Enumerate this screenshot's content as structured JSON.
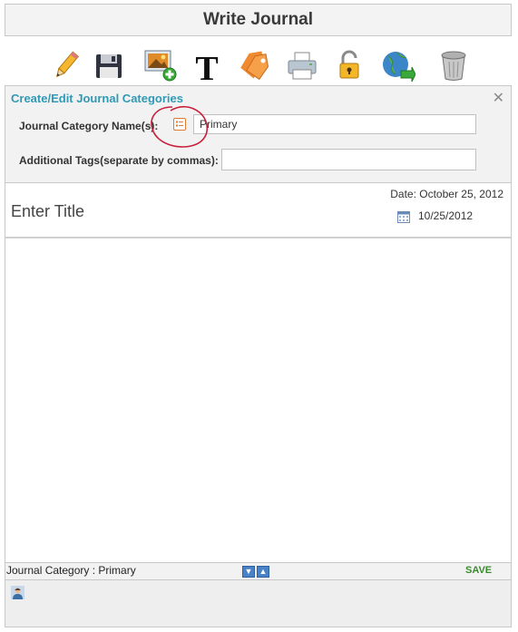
{
  "header": {
    "title": "Write Journal"
  },
  "toolbar": {
    "buttons": [
      {
        "icon": "pencil-icon"
      },
      {
        "icon": "save-icon"
      },
      {
        "icon": "add-image-icon"
      },
      {
        "icon": "text-format-icon"
      },
      {
        "icon": "tag-icon"
      },
      {
        "icon": "print-icon"
      },
      {
        "icon": "lock-icon"
      },
      {
        "icon": "globe-icon"
      },
      {
        "icon": "trash-icon"
      }
    ]
  },
  "category_panel": {
    "title": "Create/Edit Journal Categories",
    "close_label": "✕",
    "category_label": "Journal Category Name(s):",
    "category_value": "Primary",
    "tags_label": "Additional Tags(separate by commas):",
    "tags_value": ""
  },
  "entry": {
    "date_label": "Date: October 25, 2012",
    "title_placeholder": "Enter Title",
    "date_value": "10/25/2012"
  },
  "status_bar": {
    "category_text": "Journal Category : Primary",
    "down_arrow": "▼",
    "up_arrow": "▲",
    "save_label": "SAVE"
  },
  "colors": {
    "accent": "#3099b5",
    "save": "#3a8a2e",
    "annotation": "#c8203c"
  }
}
